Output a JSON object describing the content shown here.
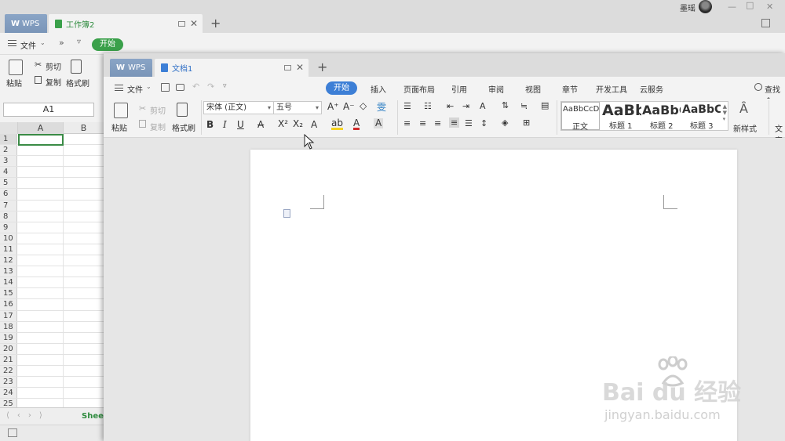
{
  "spreadsheet": {
    "tabs": {
      "wps": "WPS",
      "document": "工作簿2"
    },
    "user": {
      "name": "墨瑶"
    },
    "menu": {
      "file": "文件",
      "more": "»",
      "start": "开始"
    },
    "toolbar": {
      "paste": "粘贴",
      "cut": "剪切",
      "copy": "复制",
      "format_painter": "格式刷"
    },
    "name_box": "A1",
    "columns": [
      "A",
      "B"
    ],
    "rows": [
      "1",
      "2",
      "3",
      "4",
      "5",
      "6",
      "7",
      "8",
      "9",
      "10",
      "11",
      "12",
      "13",
      "14",
      "15",
      "16",
      "17",
      "18",
      "19",
      "20",
      "21",
      "22",
      "23",
      "24",
      "25"
    ],
    "sheet_tab": "Sheet"
  },
  "document": {
    "tabs": {
      "wps": "WPS",
      "document": "文档1"
    },
    "menu": {
      "file": "文件",
      "tabs": [
        "开始",
        "插入",
        "页面布局",
        "引用",
        "审阅",
        "视图",
        "章节",
        "开发工具",
        "云服务"
      ],
      "search": "查找命"
    },
    "ribbon": {
      "paste": "粘贴",
      "cut": "剪切",
      "copy": "复制",
      "format_painter": "格式刷",
      "font_name": "宋体 (正文)",
      "font_size": "五号",
      "styles": [
        {
          "sample": "AaBbCcDd",
          "name": "正文"
        },
        {
          "sample": "AaBb",
          "name": "标题 1"
        },
        {
          "sample": "AaBbC",
          "name": "标题 2"
        },
        {
          "sample": "AaBbC",
          "name": "标题 3"
        }
      ],
      "new_style": "新样式",
      "text_tools": "文字"
    }
  },
  "watermark": {
    "brand": "Bai du 经验",
    "url": "jingyan.baidu.com"
  },
  "colors": {
    "excel_green": "#3aa04a",
    "writer_blue": "#3d7fd6"
  }
}
